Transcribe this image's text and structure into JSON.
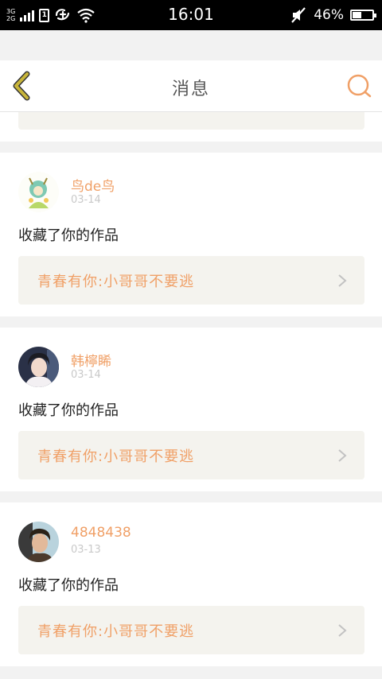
{
  "status_bar": {
    "network_top": "3G",
    "network_bottom": "2G",
    "time": "16:01",
    "battery_text": "46%",
    "battery_level": 0.46
  },
  "header": {
    "title": "消息"
  },
  "messages": [
    {
      "username": "鸟de鸟",
      "date": "03-14",
      "action": "收藏了你的作品",
      "work_title": "青春有你:小哥哥不要逃"
    },
    {
      "username": "韩檸睎",
      "date": "03-14",
      "action": "收藏了你的作品",
      "work_title": "青春有你:小哥哥不要逃"
    },
    {
      "username": "4848438",
      "date": "03-13",
      "action": "收藏了你的作品",
      "work_title": "青春有你:小哥哥不要逃"
    }
  ],
  "colors": {
    "accent": "#f0a067",
    "back_icon": "#c8b53a",
    "link_bg": "#f4f3ee"
  }
}
